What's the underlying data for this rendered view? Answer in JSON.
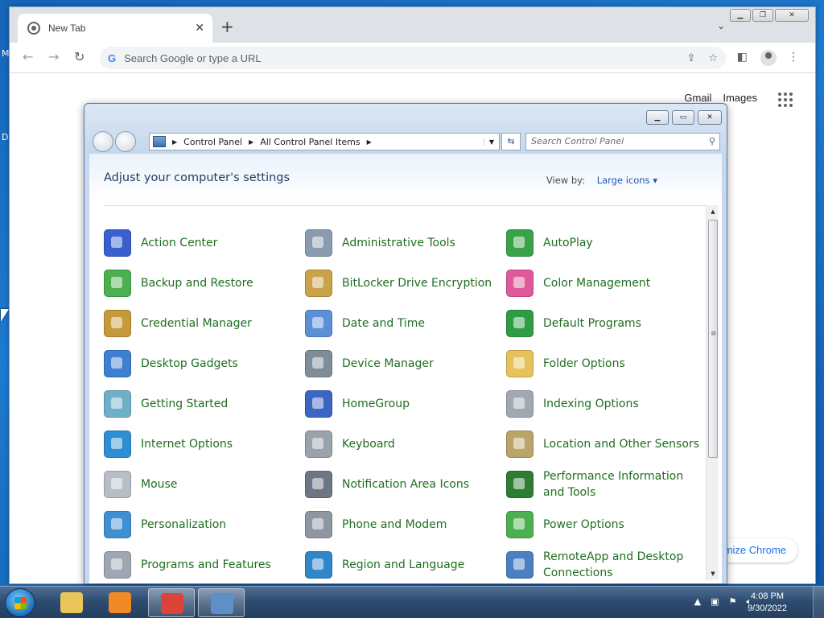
{
  "desktop": {
    "left_labels": [
      "M",
      "D"
    ]
  },
  "chrome": {
    "tab_title": "New Tab",
    "omnibox_placeholder": "Search Google or type a URL",
    "omnibox_g": "G",
    "gmail": "Gmail",
    "images": "Images",
    "customize_partial": "mize Chrome"
  },
  "control_panel": {
    "breadcrumb": [
      "Control Panel",
      "All Control Panel Items"
    ],
    "search_placeholder": "Search Control Panel",
    "heading": "Adjust your computer's settings",
    "view_by_label": "View by:",
    "view_by_value": "Large icons",
    "items": [
      {
        "label": "Action Center",
        "icon": "flag-icon",
        "color": "#3a5fcf"
      },
      {
        "label": "Administrative Tools",
        "icon": "admin-tools-icon",
        "color": "#8a9bb0"
      },
      {
        "label": "AutoPlay",
        "icon": "autoplay-icon",
        "color": "#3aa34a"
      },
      {
        "label": "Backup and Restore",
        "icon": "backup-icon",
        "color": "#4caf50"
      },
      {
        "label": "BitLocker Drive Encryption",
        "icon": "bitlocker-key-icon",
        "color": "#c9a24a"
      },
      {
        "label": "Color Management",
        "icon": "color-management-icon",
        "color": "#e05a9a"
      },
      {
        "label": "Credential Manager",
        "icon": "credential-vault-icon",
        "color": "#c49a3a"
      },
      {
        "label": "Date and Time",
        "icon": "calendar-clock-icon",
        "color": "#5b8fd6"
      },
      {
        "label": "Default Programs",
        "icon": "default-programs-icon",
        "color": "#2e9b45"
      },
      {
        "label": "Desktop Gadgets",
        "icon": "desktop-gadgets-icon",
        "color": "#3d7fd0"
      },
      {
        "label": "Device Manager",
        "icon": "device-manager-icon",
        "color": "#7f8c99"
      },
      {
        "label": "Folder Options",
        "icon": "folder-icon",
        "color": "#e6c25a"
      },
      {
        "label": "Getting Started",
        "icon": "getting-started-icon",
        "color": "#6fb0c9"
      },
      {
        "label": "HomeGroup",
        "icon": "homegroup-icon",
        "color": "#3b66c4"
      },
      {
        "label": "Indexing Options",
        "icon": "indexing-magnifier-icon",
        "color": "#a0a8b2"
      },
      {
        "label": "Internet Options",
        "icon": "internet-globe-icon",
        "color": "#2f8ed1"
      },
      {
        "label": "Keyboard",
        "icon": "keyboard-icon",
        "color": "#9aa2ab"
      },
      {
        "label": "Location and Other Sensors",
        "icon": "sensors-icon",
        "color": "#b9a46a"
      },
      {
        "label": "Mouse",
        "icon": "mouse-icon",
        "color": "#b8bec6"
      },
      {
        "label": "Notification Area Icons",
        "icon": "notification-area-icon",
        "color": "#6d7784"
      },
      {
        "label": "Performance Information and Tools",
        "icon": "performance-monitor-icon",
        "color": "#2e7d32"
      },
      {
        "label": "Personalization",
        "icon": "personalization-icon",
        "color": "#3f8fd2"
      },
      {
        "label": "Phone and Modem",
        "icon": "phone-modem-icon",
        "color": "#8d96a1"
      },
      {
        "label": "Power Options",
        "icon": "power-battery-icon",
        "color": "#4caf50"
      },
      {
        "label": "Programs and Features",
        "icon": "programs-features-icon",
        "color": "#9ea7b2"
      },
      {
        "label": "Region and Language",
        "icon": "region-globe-icon",
        "color": "#2f86c8"
      },
      {
        "label": "RemoteApp and Desktop Connections",
        "icon": "remote-desktop-icon",
        "color": "#4a7fc4"
      }
    ]
  },
  "taskbar": {
    "time": "4:08 PM",
    "date": "9/30/2022",
    "pinned": [
      {
        "name": "explorer-icon",
        "color": "#e9c65a",
        "active": false
      },
      {
        "name": "media-player-icon",
        "color": "#f08a24",
        "active": false
      },
      {
        "name": "chrome-icon",
        "color": "#db4437",
        "active": true
      },
      {
        "name": "control-panel-icon",
        "color": "#5f8fc9",
        "active": true
      }
    ]
  }
}
